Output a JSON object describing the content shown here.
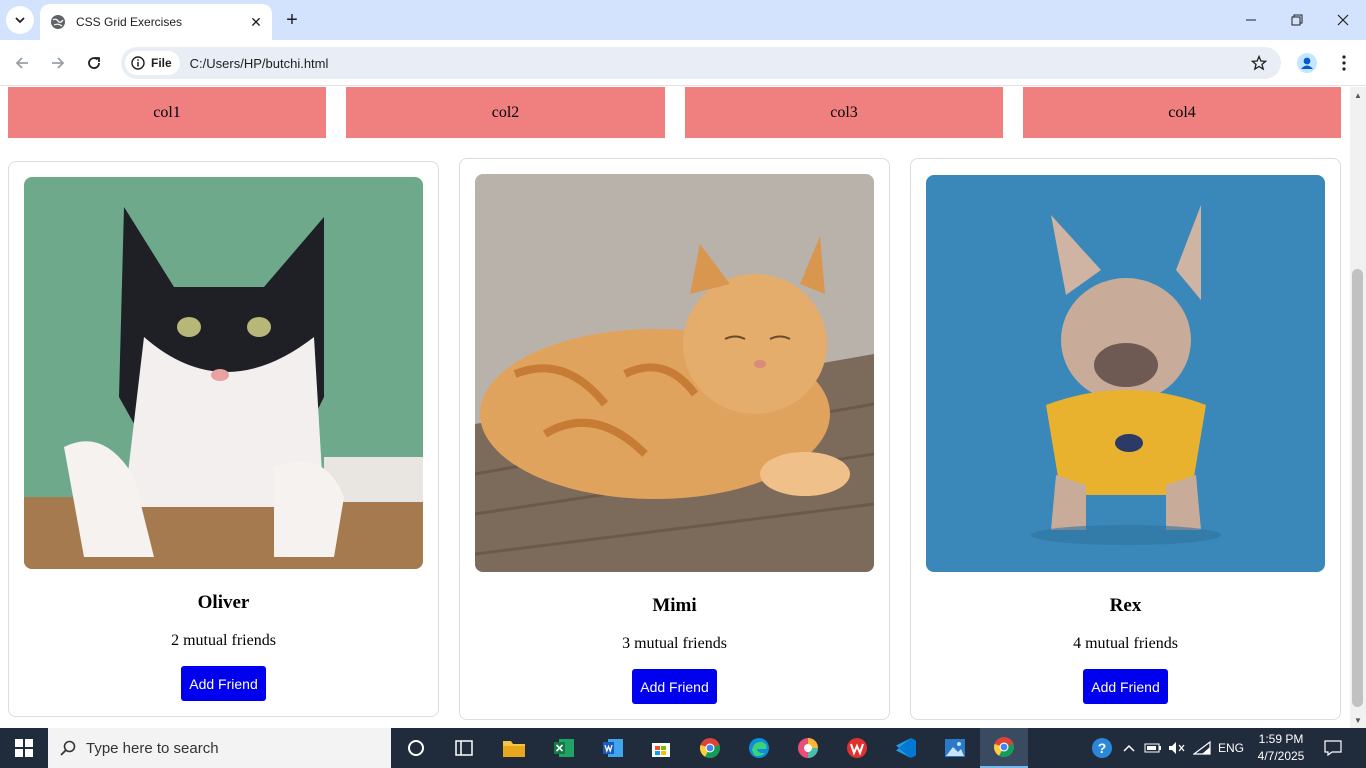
{
  "browser": {
    "tab_title": "CSS Grid Exercises",
    "new_tab_symbol": "+",
    "close_tab_symbol": "✕",
    "scheme_chip": "File",
    "url": "C:/Users/HP/butchi.html"
  },
  "page": {
    "columns": [
      "col1",
      "col2",
      "col3",
      "col4"
    ],
    "column_bg": "#f08080",
    "cards": [
      {
        "name": "Oliver",
        "mutual": "2 mutual friends",
        "button": "Add Friend",
        "photo": "cat-black-white-icon"
      },
      {
        "name": "Mimi",
        "mutual": "3 mutual friends",
        "button": "Add Friend",
        "photo": "cat-orange-tabby-icon"
      },
      {
        "name": "Rex",
        "mutual": "4 mutual friends",
        "button": "Add Friend",
        "photo": "dog-french-bulldog-icon"
      }
    ],
    "button_color": "#0000ee"
  },
  "taskbar": {
    "search_placeholder": "Type here to search",
    "language": "ENG",
    "time": "1:59 PM",
    "date": "4/7/2025"
  }
}
